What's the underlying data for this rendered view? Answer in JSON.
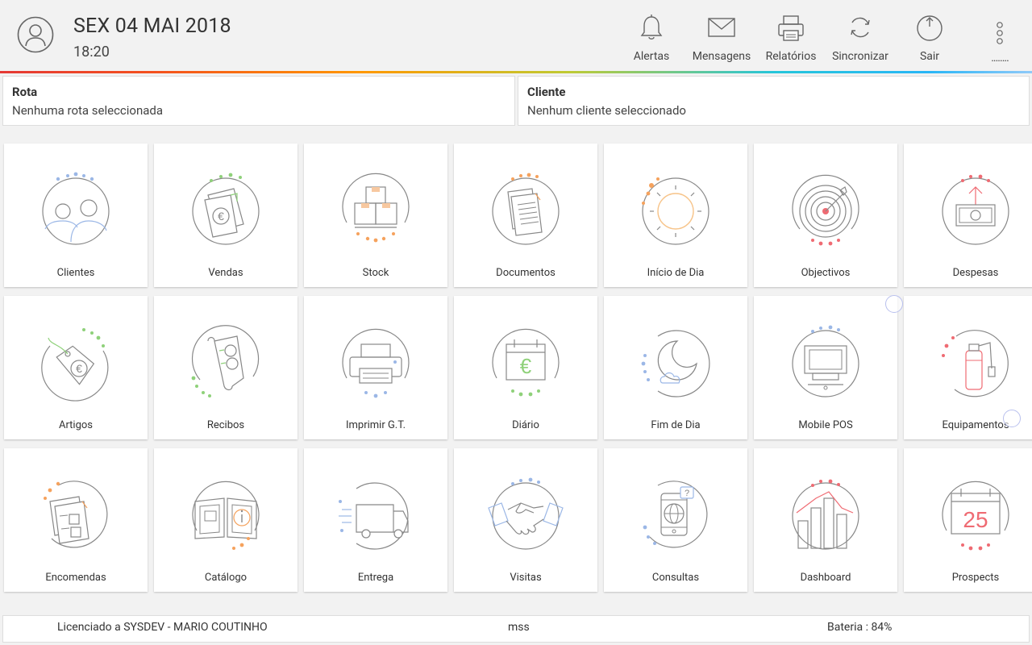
{
  "header": {
    "date": "SEX 04 MAI 2018",
    "time": "18:20",
    "toolbar": [
      {
        "label": "Alertas",
        "icon": "bell-icon"
      },
      {
        "label": "Mensagens",
        "icon": "envelope-icon"
      },
      {
        "label": "Relatórios",
        "icon": "printer-icon"
      },
      {
        "label": "Sincronizar",
        "icon": "sync-icon"
      },
      {
        "label": "Sair",
        "icon": "power-icon"
      }
    ],
    "more_label": "........"
  },
  "panels": {
    "rota": {
      "title": "Rota",
      "value": "Nenhuma rota seleccionada"
    },
    "cliente": {
      "title": "Cliente",
      "value": "Nenhum cliente seleccionado"
    }
  },
  "grid": [
    {
      "label": "Clientes",
      "icon": "clients-icon"
    },
    {
      "label": "Vendas",
      "icon": "sales-icon"
    },
    {
      "label": "Stock",
      "icon": "stock-boxes-icon"
    },
    {
      "label": "Documentos",
      "icon": "documents-icon"
    },
    {
      "label": "Início de Dia",
      "icon": "sun-icon"
    },
    {
      "label": "Objectivos",
      "icon": "target-icon"
    },
    {
      "label": "Despesas",
      "icon": "expenses-icon"
    },
    {
      "label": "Artigos",
      "icon": "price-tag-icon"
    },
    {
      "label": "Recibos",
      "icon": "receipts-icon"
    },
    {
      "label": "Imprimir G.T.",
      "icon": "printer-icon"
    },
    {
      "label": "Diário",
      "icon": "calendar-euro-icon"
    },
    {
      "label": "Fim de Dia",
      "icon": "moon-icon"
    },
    {
      "label": "Mobile POS",
      "icon": "pos-terminal-icon"
    },
    {
      "label": "Equipamentos",
      "icon": "fire-extinguisher-icon"
    },
    {
      "label": "Encomendas",
      "icon": "orders-icon"
    },
    {
      "label": "Catálogo",
      "icon": "catalog-book-icon"
    },
    {
      "label": "Entrega",
      "icon": "delivery-truck-icon"
    },
    {
      "label": "Visitas",
      "icon": "handshake-icon"
    },
    {
      "label": "Consultas",
      "icon": "tablet-globe-icon"
    },
    {
      "label": "Dashboard",
      "icon": "dashboard-chart-icon"
    },
    {
      "label": "Prospects",
      "icon": "calendar-25-icon"
    }
  ],
  "footer": {
    "license": "Licenciado a SYSDEV - MARIO COUTINHO",
    "user": "mss",
    "battery": "Bateria : 84%"
  },
  "colors": {
    "blue": "#8fb2e8",
    "green": "#8fd17a",
    "orange": "#f5a25d",
    "red": "#ef6b73",
    "gray": "#8a8a8a"
  }
}
